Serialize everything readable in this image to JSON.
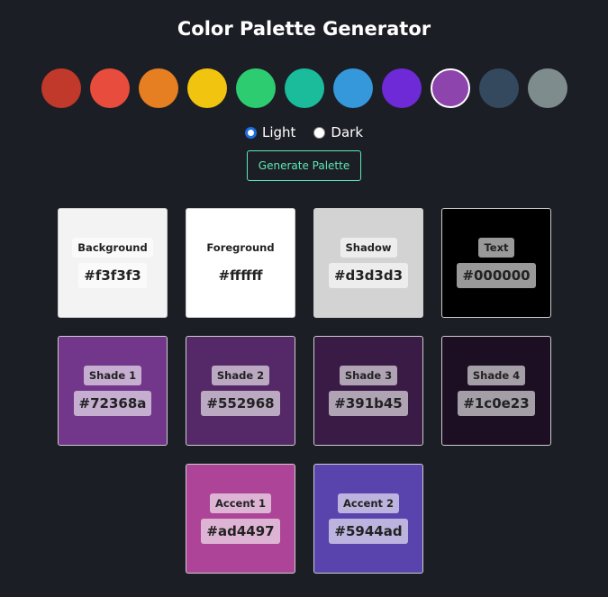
{
  "title": "Color Palette Generator",
  "base_colors": [
    "#c0392b",
    "#e74c3c",
    "#e67e22",
    "#f1c40f",
    "#2ecc71",
    "#1abc9c",
    "#3498db",
    "#6d2ad6",
    "#8e44ad",
    "#34495e",
    "#7f8c8d"
  ],
  "selected_index": 8,
  "modes": {
    "light": "Light",
    "dark": "Dark",
    "selected": "light"
  },
  "generate_label": "Generate Palette",
  "swatches": [
    {
      "label": "Background",
      "hex": "#f3f3f3"
    },
    {
      "label": "Foreground",
      "hex": "#ffffff"
    },
    {
      "label": "Shadow",
      "hex": "#d3d3d3"
    },
    {
      "label": "Text",
      "hex": "#000000"
    },
    {
      "label": "Shade 1",
      "hex": "#72368a"
    },
    {
      "label": "Shade 2",
      "hex": "#552968"
    },
    {
      "label": "Shade 3",
      "hex": "#391b45"
    },
    {
      "label": "Shade 4",
      "hex": "#1c0e23"
    },
    {
      "label": "Accent 1",
      "hex": "#ad4497"
    },
    {
      "label": "Accent 2",
      "hex": "#5944ad"
    }
  ]
}
